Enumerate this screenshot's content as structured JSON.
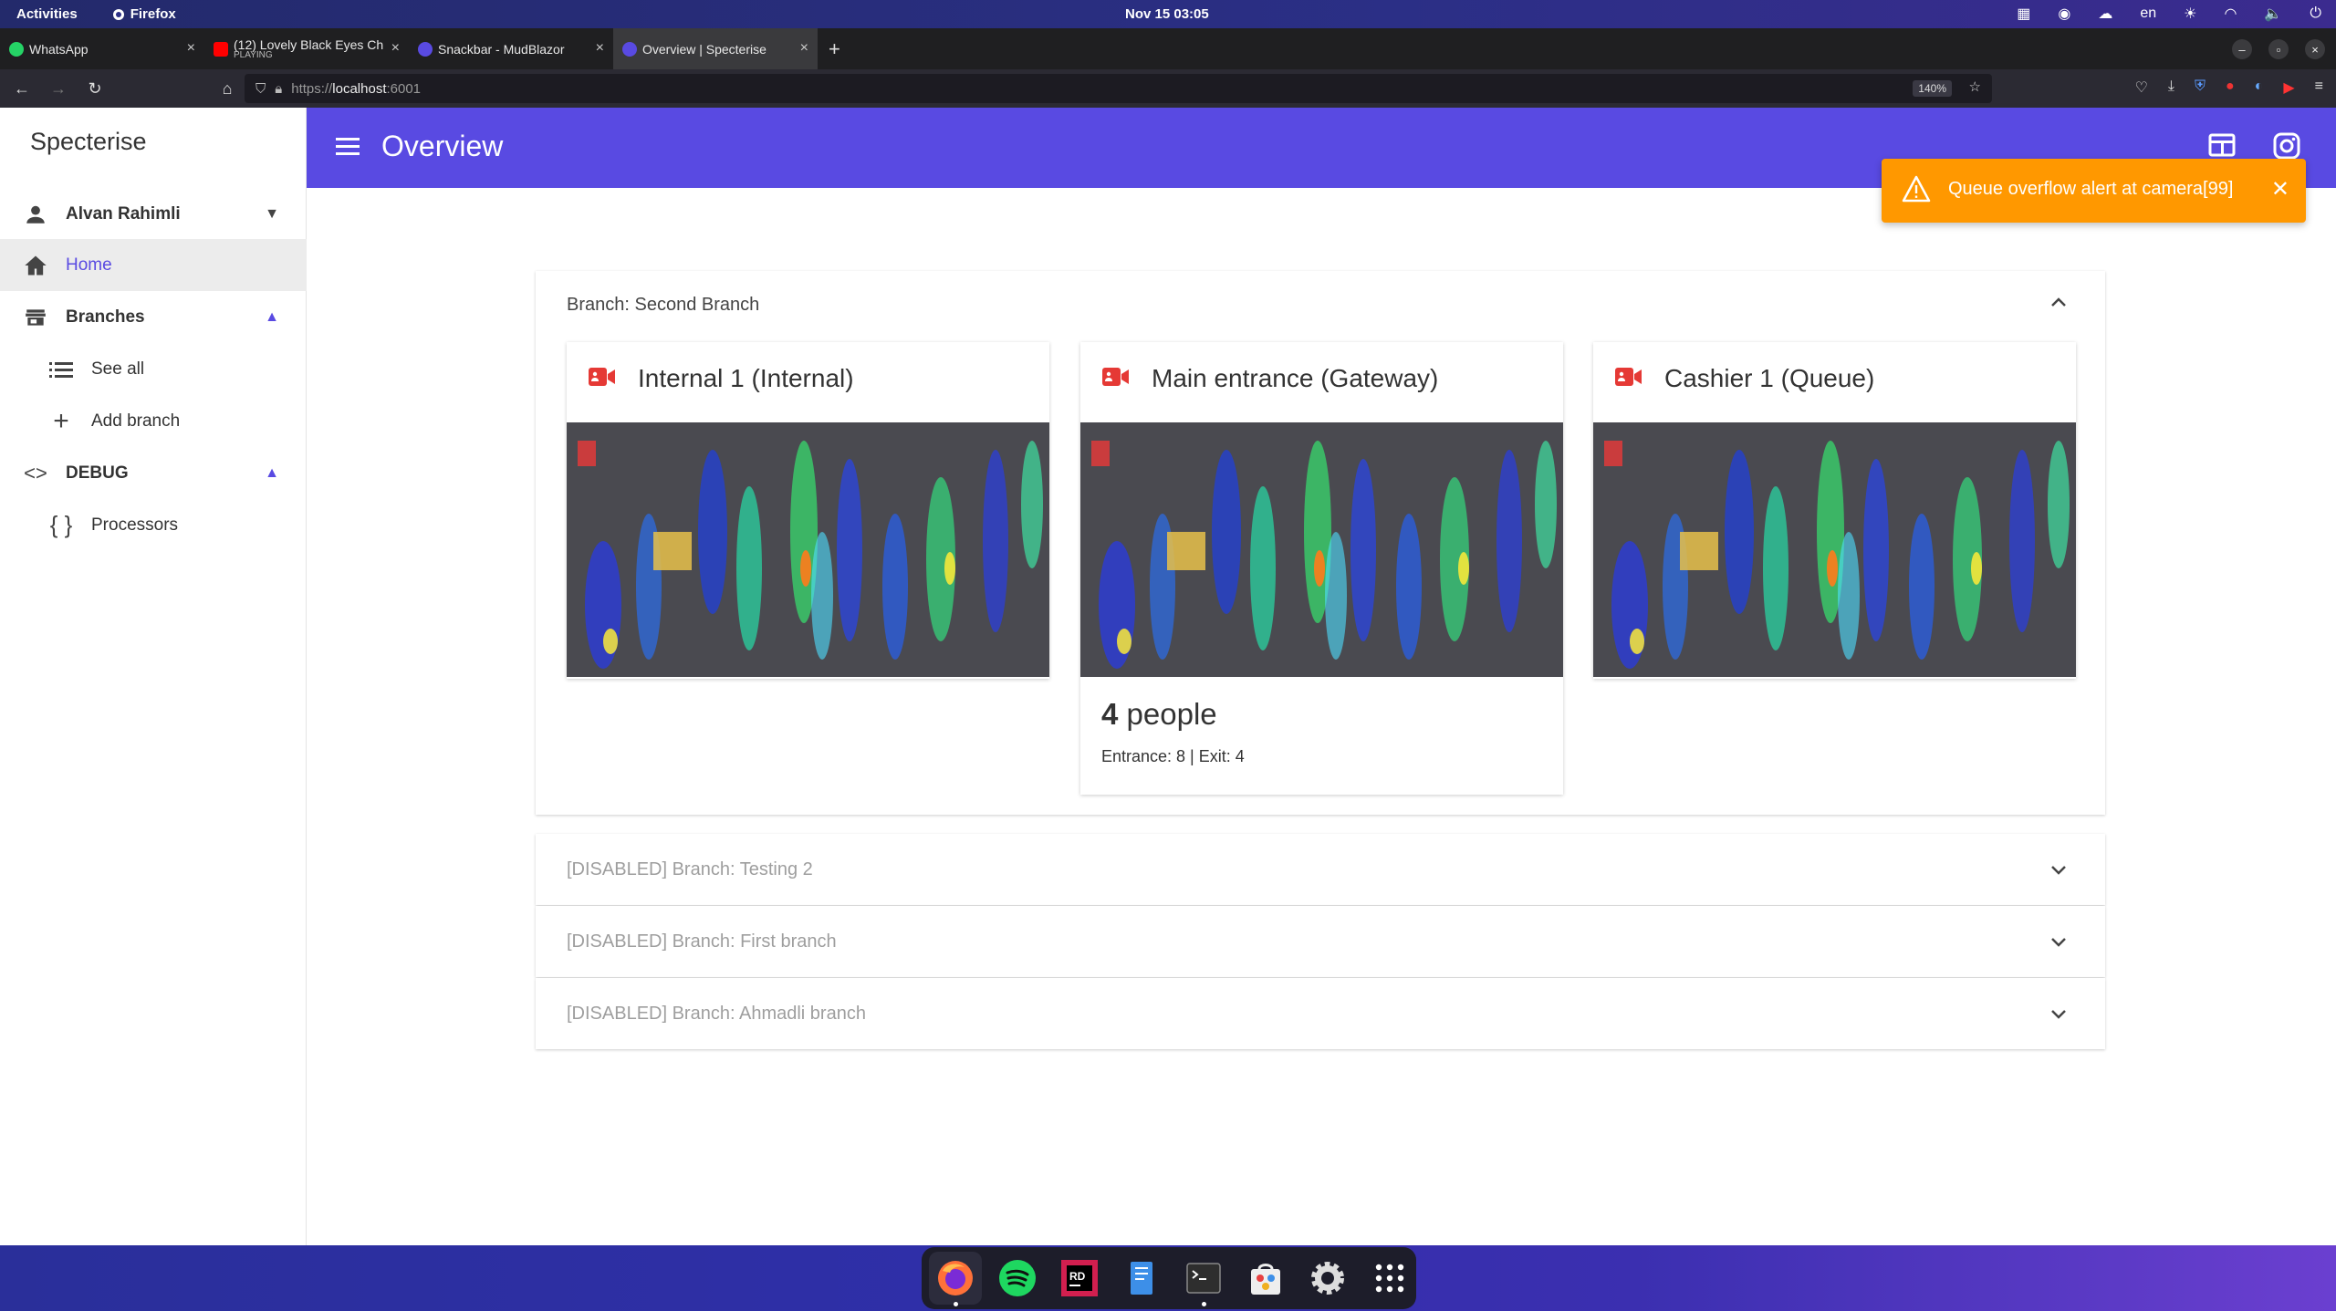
{
  "topbar": {
    "activities": "Activities",
    "app": "Firefox",
    "clock": "Nov 15  03:05",
    "lang": "en"
  },
  "tabs": [
    {
      "label": "WhatsApp",
      "sub": "",
      "active": false,
      "icon_color": "#25d366"
    },
    {
      "label": "(12) Lovely Black Eyes Ch",
      "sub": "PLAYING",
      "active": false,
      "icon_color": "#ff0000"
    },
    {
      "label": "Snackbar - MudBlazor",
      "sub": "",
      "active": false,
      "icon_color": "#594ae2"
    },
    {
      "label": "Overview | Specterise",
      "sub": "",
      "active": true,
      "icon_color": "#594ae2"
    }
  ],
  "navbar": {
    "url_prefix": "https://",
    "url_host": "localhost",
    "url_port": ":6001",
    "zoom": "140%"
  },
  "sidebar": {
    "brand": "Specterise",
    "user": "Alvan Rahimli",
    "items": [
      {
        "label": "Home"
      },
      {
        "label": "Branches"
      },
      {
        "label": "See all"
      },
      {
        "label": "Add branch"
      },
      {
        "label": "DEBUG"
      },
      {
        "label": "Processors"
      }
    ]
  },
  "appbar": {
    "title": "Overview"
  },
  "snackbar": {
    "message": "Queue overflow alert at camera[99]"
  },
  "branches": [
    {
      "title": "Branch: Second Branch",
      "cameras": [
        {
          "title": "Internal 1 (Internal)"
        },
        {
          "title": "Main entrance (Gateway)",
          "count": "4",
          "count_unit": " people",
          "stats": "Entrance: 8 | Exit: 4"
        },
        {
          "title": "Cashier 1 (Queue)"
        }
      ]
    },
    {
      "title": "[DISABLED] Branch: Testing 2"
    },
    {
      "title": "[DISABLED] Branch: First branch"
    },
    {
      "title": "[DISABLED] Branch: Ahmadli branch"
    }
  ],
  "colors": {
    "primary": "#594ae2",
    "snackbar_warning": "#ff9800",
    "camera_icon": "#e53935"
  }
}
